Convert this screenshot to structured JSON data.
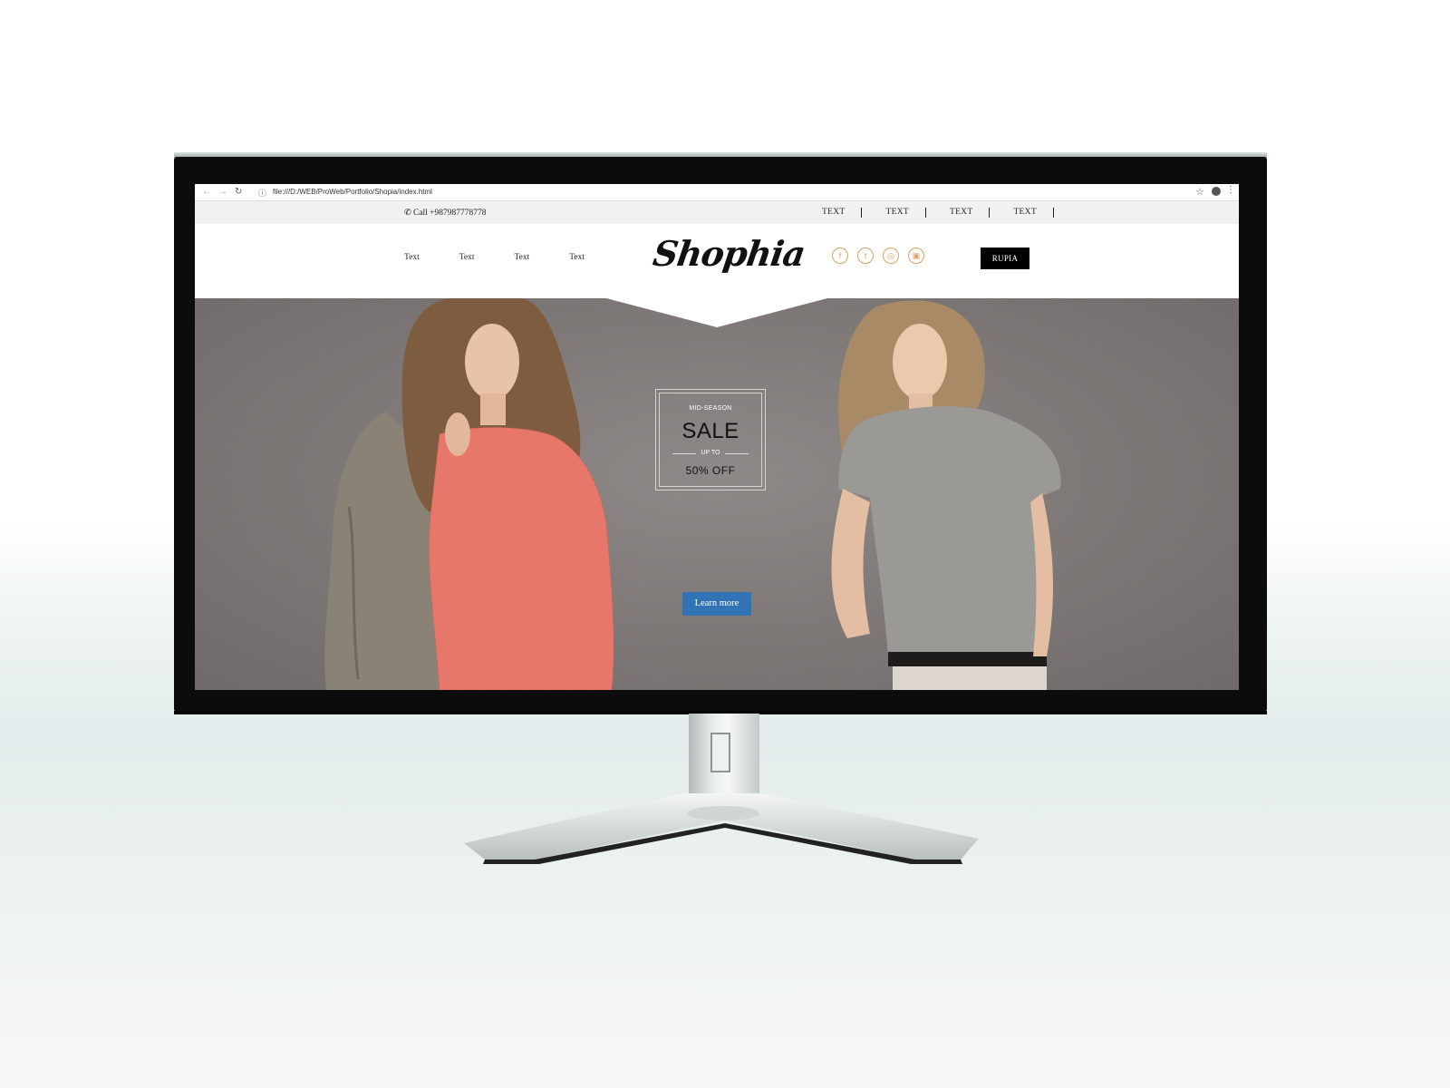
{
  "browser": {
    "url": "file:///D:/WEB/ProWeb/Portfolio/Shopia/index.html",
    "icons": [
      "back-arrow-icon",
      "forward-arrow-icon",
      "reload-icon",
      "info-icon",
      "star-icon",
      "profile-icon",
      "menu-icon"
    ]
  },
  "topbar": {
    "call": "Call +987987778778",
    "links": [
      "TEXT",
      "TEXT",
      "TEXT",
      "TEXT"
    ]
  },
  "header": {
    "nav": [
      "Text",
      "Text",
      "Text",
      "Text"
    ],
    "logo": "Shophia",
    "socials": [
      "facebook-icon",
      "twitter-icon",
      "dribbble-icon",
      "instagram-icon"
    ],
    "button": "RUPIA",
    "accent_color": "#d9a266"
  },
  "hero": {
    "sale_top": "MID-SEASON",
    "sale_main": "SALE",
    "sale_upto": "UP TO",
    "sale_value": "50% OFF",
    "cta": "Learn more",
    "cta_color": "#3173b5",
    "background_color": "#807a79"
  }
}
